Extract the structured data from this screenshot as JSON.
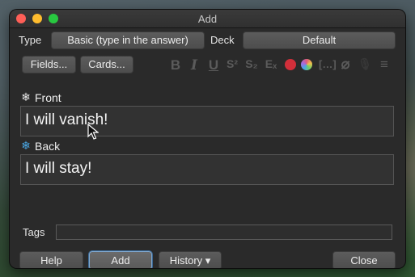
{
  "window": {
    "title": "Add"
  },
  "type_row": {
    "type_label": "Type",
    "type_value": "Basic (type in the answer)",
    "deck_label": "Deck",
    "deck_value": "Default"
  },
  "toolbar": {
    "fields_label": "Fields...",
    "cards_label": "Cards...",
    "icons": [
      "bold-icon",
      "italic-icon",
      "underline-icon",
      "superscript-icon",
      "subscript-icon",
      "clear-format-icon",
      "text-color-icon",
      "highlight-color-icon",
      "cloze-icon",
      "attach-icon",
      "record-icon",
      "more-icon"
    ],
    "glyphs": {
      "bold": "B",
      "italic": "I",
      "underline": "U",
      "superscript": "S²",
      "subscript": "S₂",
      "clear": "Eₓ",
      "cloze": "[…]",
      "attach": "⌀",
      "record": "🎙",
      "more": "≡"
    }
  },
  "fields": [
    {
      "name": "Front",
      "value": "I will vanish!",
      "sticky_icon": "snowflake-icon"
    },
    {
      "name": "Back",
      "value": "I will stay!",
      "sticky_icon": "snowflake-icon"
    }
  ],
  "sticky_glyph": "❄",
  "tags": {
    "label": "Tags",
    "value": ""
  },
  "footer": {
    "help_label": "Help",
    "add_label": "Add",
    "history_label": "History ▾",
    "close_label": "Close"
  },
  "colors": {
    "text_color_swatch": "#d12f3a",
    "highlight_swatch": "#e05b7c",
    "sticky_active": "#4aa8e6",
    "focus_ring": "#7fa8cf"
  }
}
